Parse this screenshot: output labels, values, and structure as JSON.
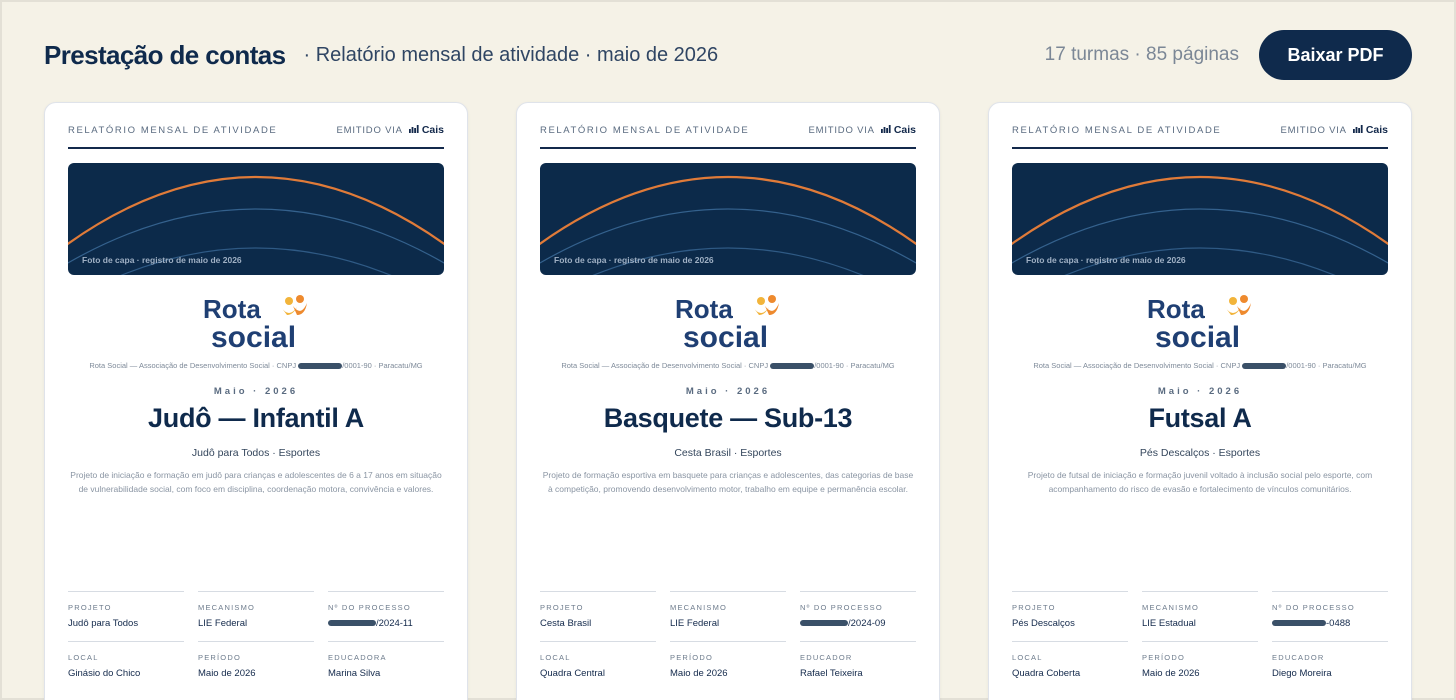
{
  "header": {
    "title": "Prestação de contas",
    "subtitle": "· Relatório mensal de atividade · maio de 2026",
    "meta": "17 turmas · 85 páginas",
    "download_label": "Baixar PDF"
  },
  "cards": [
    {
      "report_label": "RELATÓRIO MENSAL DE ATIVIDADE",
      "issued_label": "EMITIDO VIA",
      "issued_brand": "Cais",
      "cover_caption": "Foto de capa · registro de maio de 2026",
      "logo_line1": "Rota",
      "logo_line2": "social",
      "org_prefix": "Rota Social — Associação de Desenvolvimento Social · CNPJ ",
      "org_suffix": "/0001-90 · Paracatu/MG",
      "month": "Maio · 2026",
      "class_title": "Judô — Infantil A",
      "class_sub": "Judô para Todos · Esportes",
      "description": "Projeto de iniciação e formação em judô para crianças e adolescentes de 6 a 17 anos em situação de vulnerabilidade social, com foco em disciplina, coordenação motora, convivência e valores.",
      "fields": {
        "project_label": "PROJETO",
        "project_value": "Judô para Todos",
        "mechanism_label": "MECANISMO",
        "mechanism_value": "LIE Federal",
        "process_label": "Nº DO PROCESSO",
        "process_suffix": "/2024-11",
        "local_label": "LOCAL",
        "local_value": "Ginásio do Chico",
        "period_label": "PERÍODO",
        "period_value": "Maio de 2026",
        "educator_label": "EDUCADORA",
        "educator_value": "Marina Silva"
      }
    },
    {
      "report_label": "RELATÓRIO MENSAL DE ATIVIDADE",
      "issued_label": "EMITIDO VIA",
      "issued_brand": "Cais",
      "cover_caption": "Foto de capa · registro de maio de 2026",
      "logo_line1": "Rota",
      "logo_line2": "social",
      "org_prefix": "Rota Social — Associação de Desenvolvimento Social · CNPJ ",
      "org_suffix": "/0001-90 · Paracatu/MG",
      "month": "Maio · 2026",
      "class_title": "Basquete — Sub-13",
      "class_sub": "Cesta Brasil · Esportes",
      "description": "Projeto de formação esportiva em basquete para crianças e adolescentes, das categorias de base à competição, promovendo desenvolvimento motor, trabalho em equipe e permanência escolar.",
      "fields": {
        "project_label": "PROJETO",
        "project_value": "Cesta Brasil",
        "mechanism_label": "MECANISMO",
        "mechanism_value": "LIE Federal",
        "process_label": "Nº DO PROCESSO",
        "process_suffix": "/2024-09",
        "local_label": "LOCAL",
        "local_value": "Quadra Central",
        "period_label": "PERÍODO",
        "period_value": "Maio de 2026",
        "educator_label": "EDUCADOR",
        "educator_value": "Rafael Teixeira"
      }
    },
    {
      "report_label": "RELATÓRIO MENSAL DE ATIVIDADE",
      "issued_label": "EMITIDO VIA",
      "issued_brand": "Cais",
      "cover_caption": "Foto de capa · registro de maio de 2026",
      "logo_line1": "Rota",
      "logo_line2": "social",
      "org_prefix": "Rota Social — Associação de Desenvolvimento Social · CNPJ ",
      "org_suffix": "/0001-90 · Paracatu/MG",
      "month": "Maio · 2026",
      "class_title": "Futsal A",
      "class_sub": "Pés Descalços · Esportes",
      "description": "Projeto de futsal de iniciação e formação juvenil voltado à inclusão social pelo esporte, com acompanhamento do risco de evasão e fortalecimento de vínculos comunitários.",
      "fields": {
        "project_label": "PROJETO",
        "project_value": "Pés Descalços",
        "mechanism_label": "MECANISMO",
        "mechanism_value": "LIE Estadual",
        "process_label": "Nº DO PROCESSO",
        "process_suffix": "-0488",
        "local_label": "LOCAL",
        "local_value": "Quadra Coberta",
        "period_label": "PERÍODO",
        "period_value": "Maio de 2026",
        "educator_label": "EDUCADOR",
        "educator_value": "Diego Moreira"
      }
    }
  ],
  "colors": {
    "navy": "#0f2a4c",
    "cover": "#0c2a4a",
    "arc_orange": "#e07b39",
    "arc_blue": "#3f6f9e",
    "logo_orange": "#ee8a2e",
    "logo_yellow": "#f2b43a",
    "background": "#f5f2e7"
  },
  "icons": [
    "bar-chart-icon",
    "people-logo-icon"
  ]
}
